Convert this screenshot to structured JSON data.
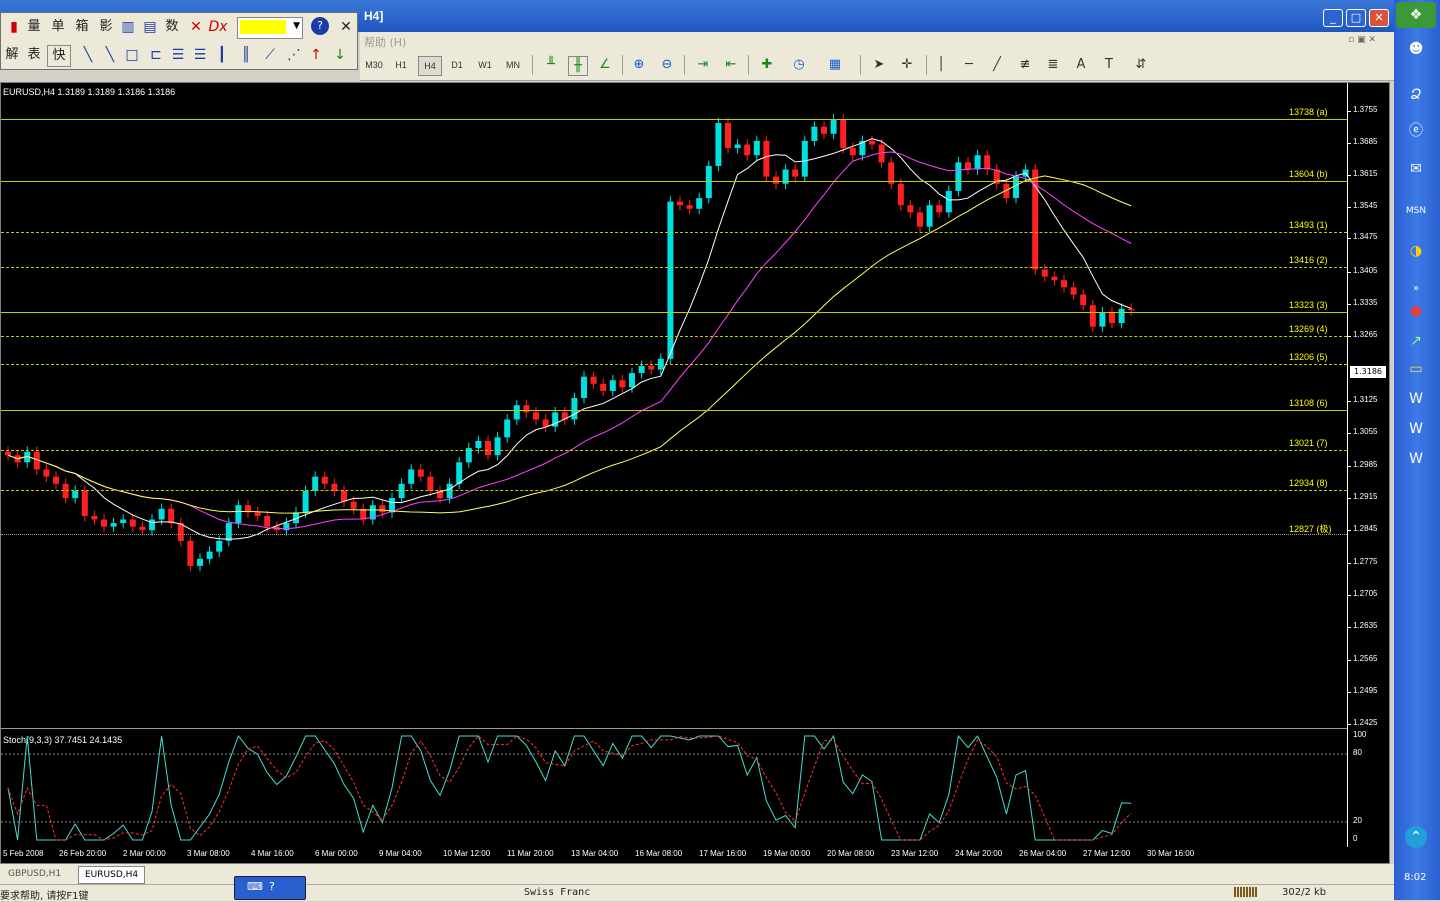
{
  "window": {
    "title": "H4]",
    "menu_item": "帮助 (H)"
  },
  "floating_toolbar": {
    "row1": [
      "量",
      "单",
      "箱",
      "影",
      "数"
    ],
    "row2": [
      "解",
      "表",
      "快"
    ]
  },
  "timeframes": [
    "M30",
    "H1",
    "H4",
    "D1",
    "W1",
    "MN"
  ],
  "selected_timeframe": "H4",
  "chart": {
    "symbol_info": "EURUSD,H4  1.3189 1.3189 1.3186 1.3186",
    "stoch_info": "Stoch(9,3,3) 37.7451 24.1435",
    "current_price": "1.3186",
    "price_ticks": [
      "1.3755",
      "1.3685",
      "1.3615",
      "1.3545",
      "1.3475",
      "1.3405",
      "1.3335",
      "1.3265",
      "1.3125",
      "1.3055",
      "1.2985",
      "1.2915",
      "1.2845",
      "1.2775",
      "1.2705",
      "1.2635",
      "1.2565",
      "1.2495",
      "1.2425"
    ],
    "stoch_ticks": [
      "100",
      "80",
      "20",
      "0"
    ],
    "levels": [
      {
        "label": "13738 (a)",
        "style": "solid"
      },
      {
        "label": "13604 (b)",
        "style": "solid"
      },
      {
        "label": "13493 (1)",
        "style": "dash"
      },
      {
        "label": "13416 (2)",
        "style": "dash"
      },
      {
        "label": "13323 (3)",
        "style": "solid"
      },
      {
        "label": "13269 (4)",
        "style": "dash"
      },
      {
        "label": "13206 (5)",
        "style": "dash"
      },
      {
        "label": "13108 (6)",
        "style": "solid"
      },
      {
        "label": "13021 (7)",
        "style": "dash"
      },
      {
        "label": "12934 (8)",
        "style": "dash"
      },
      {
        "label": "12827 (极)",
        "style": "gray"
      }
    ],
    "time_labels": [
      "5 Feb 2008",
      "26 Feb 20:00",
      "2 Mar 00:00",
      "3 Mar 08:00",
      "4 Mar 16:00",
      "6 Mar 00:00",
      "9 Mar 04:00",
      "10 Mar 12:00",
      "11 Mar 20:00",
      "13 Mar 04:00",
      "16 Mar 08:00",
      "17 Mar 16:00",
      "19 Mar 00:00",
      "20 Mar 08:00",
      "23 Mar 12:00",
      "24 Mar 20:00",
      "26 Mar 04:00",
      "27 Mar 12:00",
      "30 Mar 16:00"
    ],
    "colors": {
      "bull": "#00e0e0",
      "bear": "#ff2020",
      "ma_fast": "#ffffff",
      "ma_mid": "#ff40ff",
      "ma_slow": "#ffff60",
      "level": "#c8c800"
    }
  },
  "tabs": [
    "GBPUSD,H1",
    "EURUSD,H4"
  ],
  "active_tab": "EURUSD,H4",
  "status": {
    "help": "要求帮助, 请按F1键",
    "center": "Swiss Franc",
    "right": "302/2 kb"
  },
  "taskbar": {
    "clock": "8:02"
  }
}
